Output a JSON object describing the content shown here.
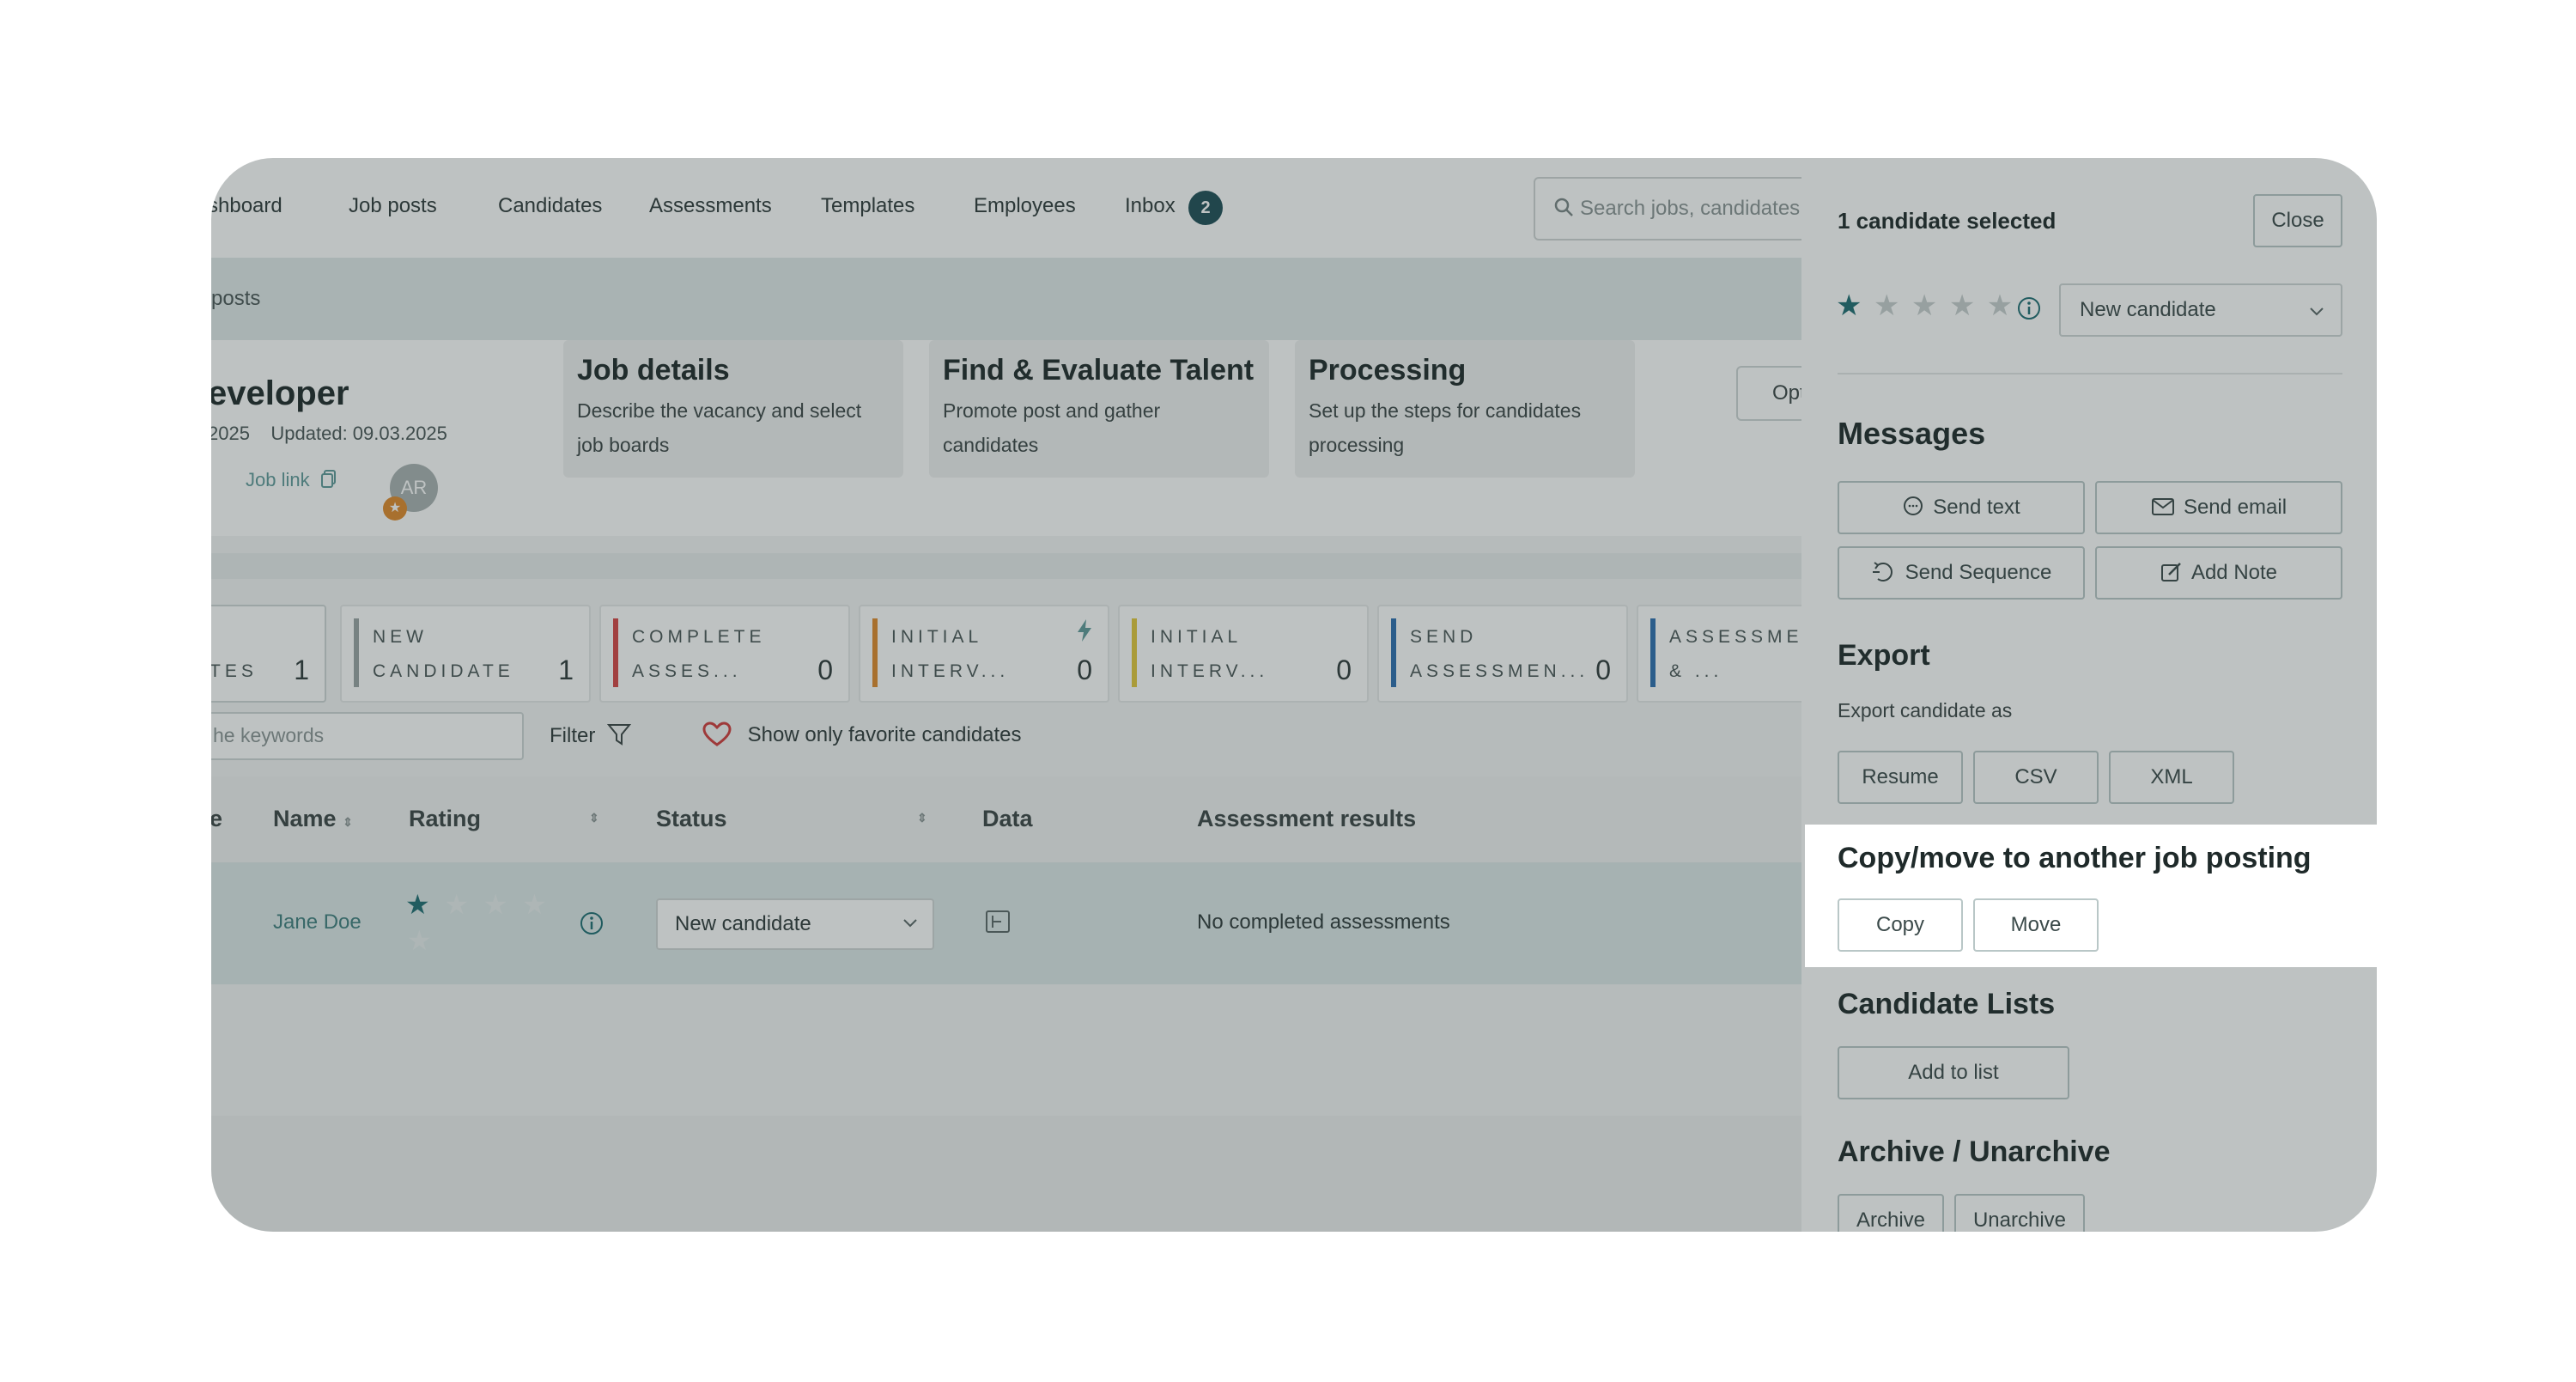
{
  "nav": {
    "items": [
      "shboard",
      "Job posts",
      "Candidates",
      "Assessments",
      "Templates",
      "Employees",
      "Inbox"
    ],
    "inbox_count": "2",
    "search_placeholder": "Search jobs, candidates,"
  },
  "breadcrumb": "posts",
  "job": {
    "title": "eveloper",
    "dates": "2025    Updated: 09.03.2025",
    "job_link": "Job link",
    "avatar_initials": "AR",
    "options_label": "Opt"
  },
  "cards": [
    {
      "title": "Job details",
      "desc": "Describe the vacancy and select job boards"
    },
    {
      "title": "Find & Evaluate Talent",
      "desc": "Promote post and gather candidates"
    },
    {
      "title": "Processing",
      "desc": "Set up the steps for candidates processing"
    }
  ],
  "pipeline": [
    {
      "l1": "",
      "l2": "TES",
      "count": "1",
      "color": "#ffffff"
    },
    {
      "l1": "NEW",
      "l2": "CANDIDATE",
      "count": "1",
      "color": "#9aa4a4"
    },
    {
      "l1": "COMPLETE",
      "l2": "ASSES...",
      "count": "0",
      "color": "#d64545"
    },
    {
      "l1": "INITIAL",
      "l2": "INTERV...",
      "count": "0",
      "color": "#e08a2b"
    },
    {
      "l1": "INITIAL",
      "l2": "INTERV...",
      "count": "0",
      "color": "#e3c73a"
    },
    {
      "l1": "SEND",
      "l2": "ASSESSMEN...",
      "count": "0",
      "color": "#2d6fb0"
    },
    {
      "l1": "ASSESSMEN",
      "l2": "& ...",
      "count": "",
      "color": "#2d6fb0"
    }
  ],
  "filters": {
    "keywords_placeholder": "he keywords",
    "filter_label": "Filter",
    "favorites_label": "Show only favorite candidates"
  },
  "table": {
    "headers": [
      "e",
      "Name",
      "Rating",
      "Status",
      "Data",
      "Assessment results"
    ],
    "row": {
      "name": "Jane Doe",
      "rating": 1,
      "status": "New candidate",
      "assessment": "No completed assessments"
    }
  },
  "panel": {
    "selected": "1 candidate selected",
    "close": "Close",
    "rating": 1,
    "status": "New candidate",
    "messages_title": "Messages",
    "send_text": "Send text",
    "send_email": "Send email",
    "send_sequence": "Send Sequence",
    "add_note": "Add Note",
    "export_title": "Export",
    "export_sub": "Export candidate as",
    "resume": "Resume",
    "csv": "CSV",
    "xml": "XML",
    "copy_title": "Copy/move to another job posting",
    "copy": "Copy",
    "move": "Move",
    "lists_title": "Candidate Lists",
    "add_to_list": "Add to list",
    "archive_title": "Archive / Unarchive",
    "archive": "Archive",
    "unarchive": "Unarchive"
  },
  "colors": {
    "accent": "#1f6e73",
    "badge": "#1f4e56",
    "star": "#1f6e73"
  }
}
